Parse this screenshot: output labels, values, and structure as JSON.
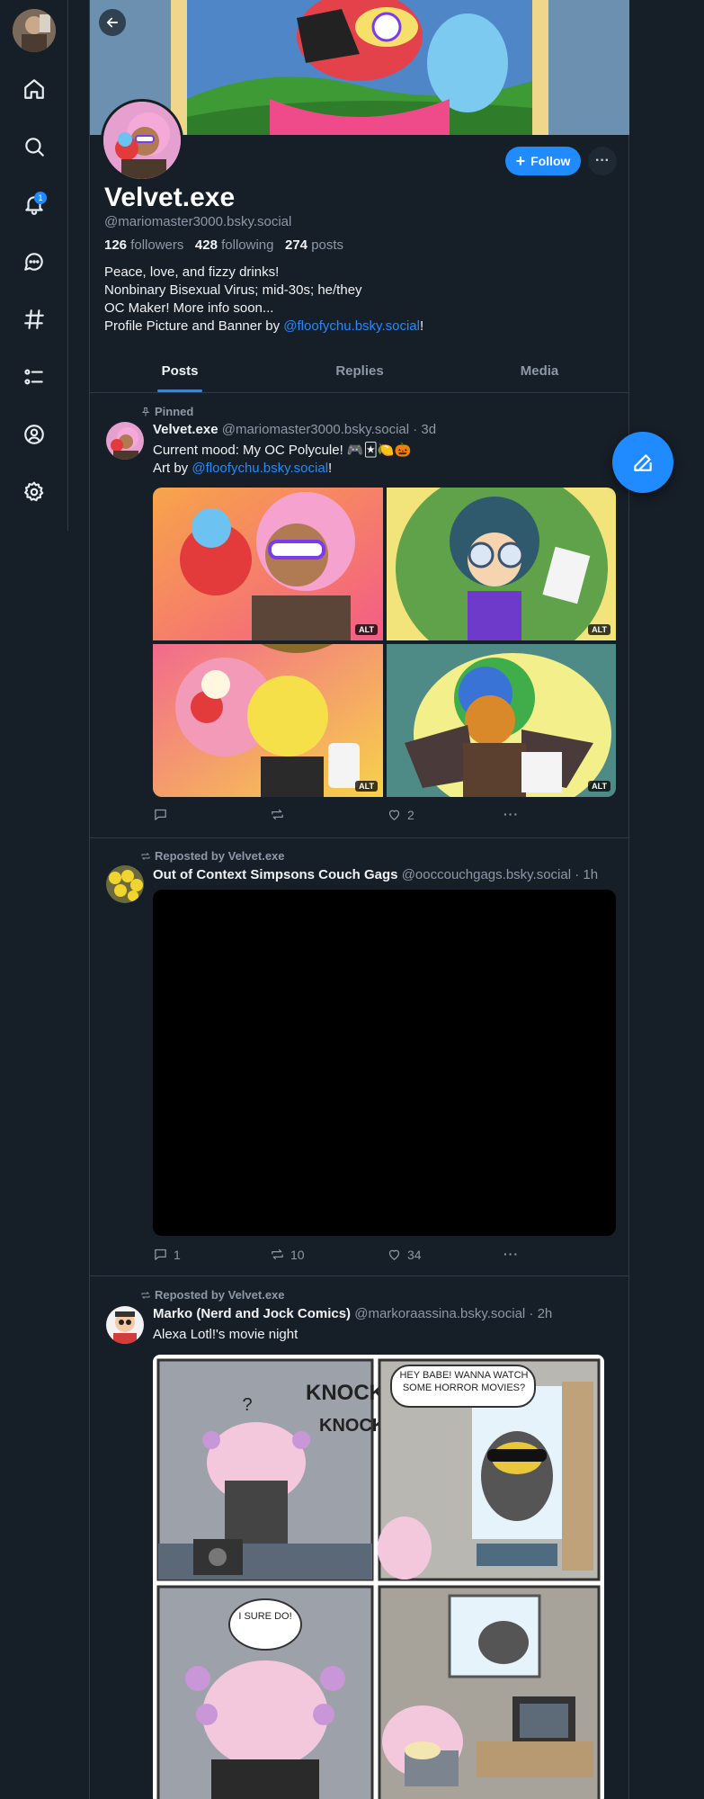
{
  "nav": {
    "notifications_count": "1",
    "items": [
      "home",
      "search",
      "notifications",
      "chat",
      "feeds",
      "lists",
      "profile",
      "settings"
    ]
  },
  "profile": {
    "display_name": "Velvet.exe",
    "handle": "@mariomaster3000.bsky.social",
    "followers_count": "126",
    "followers_label": "followers",
    "following_count": "428",
    "following_label": "following",
    "posts_count": "274",
    "posts_label": "posts",
    "bio_line1": "Peace, love, and fizzy drinks!",
    "bio_line2": "Nonbinary Bisexual Virus; mid-30s; he/they",
    "bio_line3": "OC Maker! More info soon...",
    "bio_line4_prefix": "Profile Picture and Banner by ",
    "bio_line4_link": "@floofychu.bsky.social",
    "bio_line4_suffix": "!",
    "follow_label": "Follow",
    "more_label": "···"
  },
  "tabs": [
    "Posts",
    "Replies",
    "Media"
  ],
  "posts": [
    {
      "context": "Pinned",
      "author": "Velvet.exe",
      "handle": "@mariomaster3000.bsky.social",
      "time": "· 3d",
      "text_line1": "Current mood: My OC Polycule! 🎮🃏🍋🎃",
      "text_line2_prefix": "Art by ",
      "text_line2_link": "@floofychu.bsky.social",
      "text_line2_suffix": "!",
      "alt_label": "ALT",
      "replies": "",
      "reposts": "",
      "likes": "2"
    },
    {
      "context": "Reposted by Velvet.exe",
      "author": "Out of Context Simpsons Couch Gags",
      "handle": "@ooccouchgags.bsky.social",
      "time": "· 1h",
      "replies": "1",
      "reposts": "10",
      "likes": "34"
    },
    {
      "context": "Reposted by Velvet.exe",
      "author": "Marko (Nerd and Jock Comics)",
      "handle": "@markoraassina.bsky.social",
      "time": "· 2h",
      "text_line1": "Alexa Lotl!'s movie night",
      "comic_text1": "KNOCK",
      "comic_text2": "KNOCK",
      "comic_text3": "?",
      "comic_text4": "HEY BABE! WANNA WATCH SOME HORROR MOVIES?",
      "comic_text5": "I SURE DO!"
    }
  ],
  "colors": {
    "accent": "#208bfe",
    "background": "#161e27",
    "border": "#2e3a48",
    "muted": "#8d99a6"
  }
}
